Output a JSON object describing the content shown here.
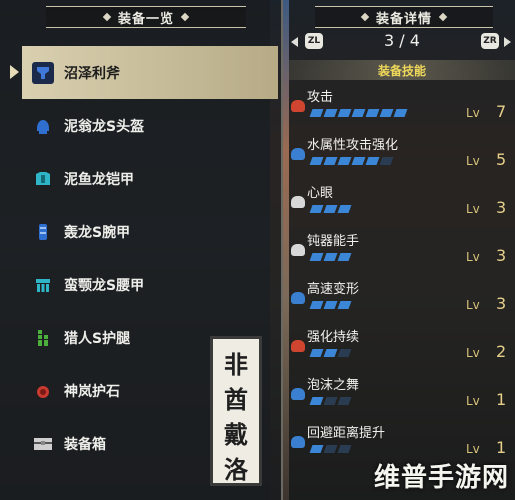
{
  "equipment_panel": {
    "title": "装备一览",
    "items": [
      {
        "label": "沼泽利斧",
        "icon": "switch-axe-icon",
        "icon_color": "#2f5fb8"
      },
      {
        "label": "泥翁龙S头盔",
        "icon": "helmet-icon",
        "icon_color": "#2f6fd0"
      },
      {
        "label": "泥鱼龙铠甲",
        "icon": "chest-armor-icon",
        "icon_color": "#2fb5c8"
      },
      {
        "label": "轰龙S腕甲",
        "icon": "gauntlet-icon",
        "icon_color": "#2f6fd0"
      },
      {
        "label": "蛮颚龙S腰甲",
        "icon": "waist-armor-icon",
        "icon_color": "#2fb5c8"
      },
      {
        "label": "猎人S护腿",
        "icon": "leg-armor-icon",
        "icon_color": "#4caf3c"
      },
      {
        "label": "神岚护石",
        "icon": "charm-icon",
        "icon_color": "#c8392f"
      },
      {
        "label": "装备箱",
        "icon": "equipment-box-icon",
        "icon_color": "#cfcfcf"
      }
    ],
    "selected_index": 0
  },
  "detail_panel": {
    "title": "装备详情",
    "left_button": "ZL",
    "right_button": "ZR",
    "page": "3 / 4",
    "skills_header": "装备技能",
    "skills": [
      {
        "name": "攻击",
        "lv_label": "Lv",
        "level": "7",
        "filled": 7,
        "max": 7,
        "icon_color": "#d0452f"
      },
      {
        "name": "水属性攻击强化",
        "lv_label": "Lv",
        "level": "5",
        "filled": 5,
        "max": 6,
        "icon_color": "#3a7fd0"
      },
      {
        "name": "心眼",
        "lv_label": "Lv",
        "level": "3",
        "filled": 3,
        "max": 3,
        "icon_color": "#d8d8d8"
      },
      {
        "name": "钝器能手",
        "lv_label": "Lv",
        "level": "3",
        "filled": 3,
        "max": 3,
        "icon_color": "#d8d8d8"
      },
      {
        "name": "高速变形",
        "lv_label": "Lv",
        "level": "3",
        "filled": 3,
        "max": 3,
        "icon_color": "#3a7fd0"
      },
      {
        "name": "强化持续",
        "lv_label": "Lv",
        "level": "2",
        "filled": 2,
        "max": 3,
        "icon_color": "#d0452f"
      },
      {
        "name": "泡沫之舞",
        "lv_label": "Lv",
        "level": "1",
        "filled": 1,
        "max": 3,
        "icon_color": "#3a7fd0"
      },
      {
        "name": "回避距离提升",
        "lv_label": "Lv",
        "level": "1",
        "filled": 1,
        "max": 3,
        "icon_color": "#3a7fd0"
      }
    ]
  },
  "watermark": {
    "seal_chars": [
      "非",
      "酋",
      "戴",
      "洛"
    ],
    "logo_text": "维普手游网"
  },
  "colors": {
    "selected_bg": "#d9d0b0",
    "skill_pip": "#3b86d6",
    "skills_header": "#f0d95a",
    "level_text": "#d7c27a"
  }
}
